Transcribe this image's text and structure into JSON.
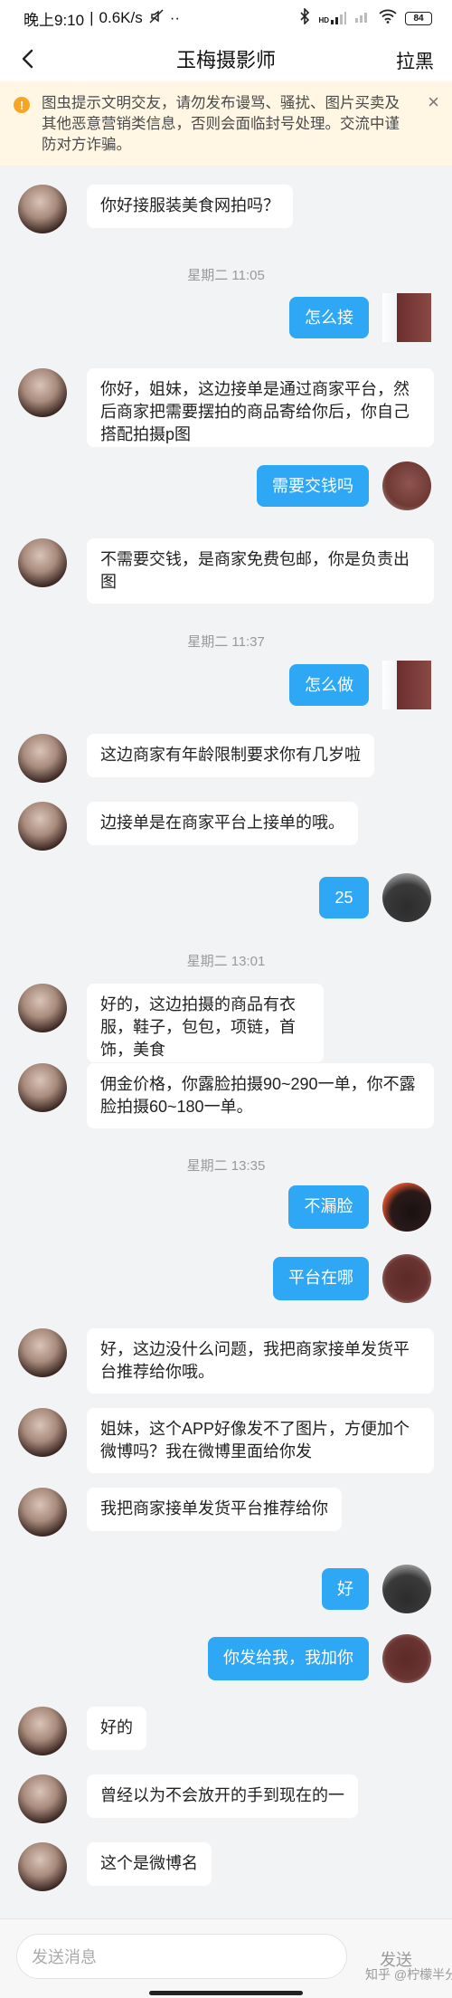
{
  "status_bar": {
    "time": "晚上9:10",
    "separator": "|",
    "net_speed": "0.6K/s",
    "more": "··",
    "signal": "HD",
    "battery": "84"
  },
  "header": {
    "title": "玉梅摄影师",
    "block_label": "拉黑"
  },
  "notice": {
    "icon": "warning-icon",
    "text": "图虫提示文明交友，请勿发布谩骂、骚扰、图片买卖及其他恶意营销类信息，否则会面临封号处理。交流中谨防对方诈骗。",
    "close": "×"
  },
  "messages": [
    {
      "text": "你好接服装美食网拍吗？"
    },
    {
      "text": "星期二 11:05"
    },
    {
      "text": "怎么接"
    },
    {
      "text": "你好，姐妹，这边接单是通过商家平台，然后商家把需要摆拍的商品寄给你后，你自己搭配拍摄p图"
    },
    {
      "text": "需要交钱吗"
    },
    {
      "text": "不需要交钱，是商家免费包邮，你是负责出图"
    },
    {
      "text": "星期二 11:37"
    },
    {
      "text": "怎么做"
    },
    {
      "text": "这边商家有年龄限制要求你有几岁啦"
    },
    {
      "text": "边接单是在商家平台上接单的哦。"
    },
    {
      "text": "25"
    },
    {
      "text": "星期二 13:01"
    },
    {
      "text": "好的，这边拍摄的商品有衣服，鞋子，包包，项链，首饰，美食"
    },
    {
      "text": "佣金价格，你露脸拍摄90~290一单，你不露脸拍摄60~180一单。"
    },
    {
      "text": "星期二 13:35"
    },
    {
      "text": "不漏脸"
    },
    {
      "text": "平台在哪"
    },
    {
      "text": "好，这边没什么问题，我把商家接单发货平台推荐给你哦。"
    },
    {
      "text": "姐妹，这个APP好像发不了图片，方便加个微博吗？我在微博里面给你发"
    },
    {
      "text": "我把商家接单发货平台推荐给你"
    },
    {
      "text": "好"
    },
    {
      "text": "你发给我，我加你"
    },
    {
      "text": "好的"
    },
    {
      "text": "曾经以为不会放开的手到现在的一"
    },
    {
      "text": "这个是微博名"
    }
  ],
  "input": {
    "placeholder": "发送消息",
    "send_label": "发送"
  },
  "watermark": "知乎 @柠檬半分甜",
  "colors": {
    "accent": "#2ea7f5",
    "background": "#f2f3f5",
    "notice_bg": "#fff6e4"
  }
}
